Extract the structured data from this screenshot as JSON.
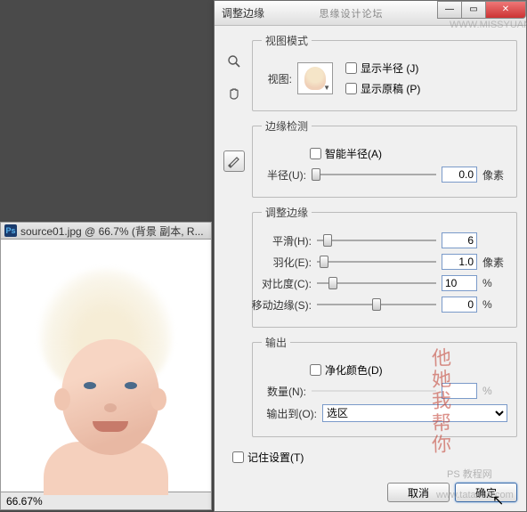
{
  "doc": {
    "title": "source01.jpg @ 66.7% (背景 副本, R...",
    "zoom": "66.67%"
  },
  "dialog": {
    "title": "调整边缘",
    "header_center": "思缘设计论坛",
    "view_mode": {
      "legend": "视图模式",
      "view_label": "视图:",
      "show_radius": "显示半径 (J)",
      "show_original": "显示原稿 (P)"
    },
    "edge_detect": {
      "legend": "边缘检测",
      "smart_radius": "智能半径(A)",
      "radius_label": "半径(U):",
      "radius_value": "0.0",
      "radius_unit": "像素"
    },
    "adjust": {
      "legend": "调整边缘",
      "smooth_label": "平滑(H):",
      "smooth_value": "6",
      "feather_label": "羽化(E):",
      "feather_value": "1.0",
      "feather_unit": "像素",
      "contrast_label": "对比度(C):",
      "contrast_value": "10",
      "contrast_unit": "%",
      "shift_label": "移动边缘(S):",
      "shift_value": "0",
      "shift_unit": "%"
    },
    "output": {
      "legend": "输出",
      "decon_label": "净化颜色(D)",
      "amount_label": "数量(N):",
      "amount_unit": "%",
      "output_to_label": "输出到(O):",
      "output_to_value": "选区"
    },
    "remember": "记住设置(T)",
    "cancel": "取消",
    "ok": "确定"
  },
  "watermarks": {
    "url1": "WWW.MISSYUAN.COM",
    "url2": "www.tata580.com",
    "text3": "PS 教程网"
  }
}
